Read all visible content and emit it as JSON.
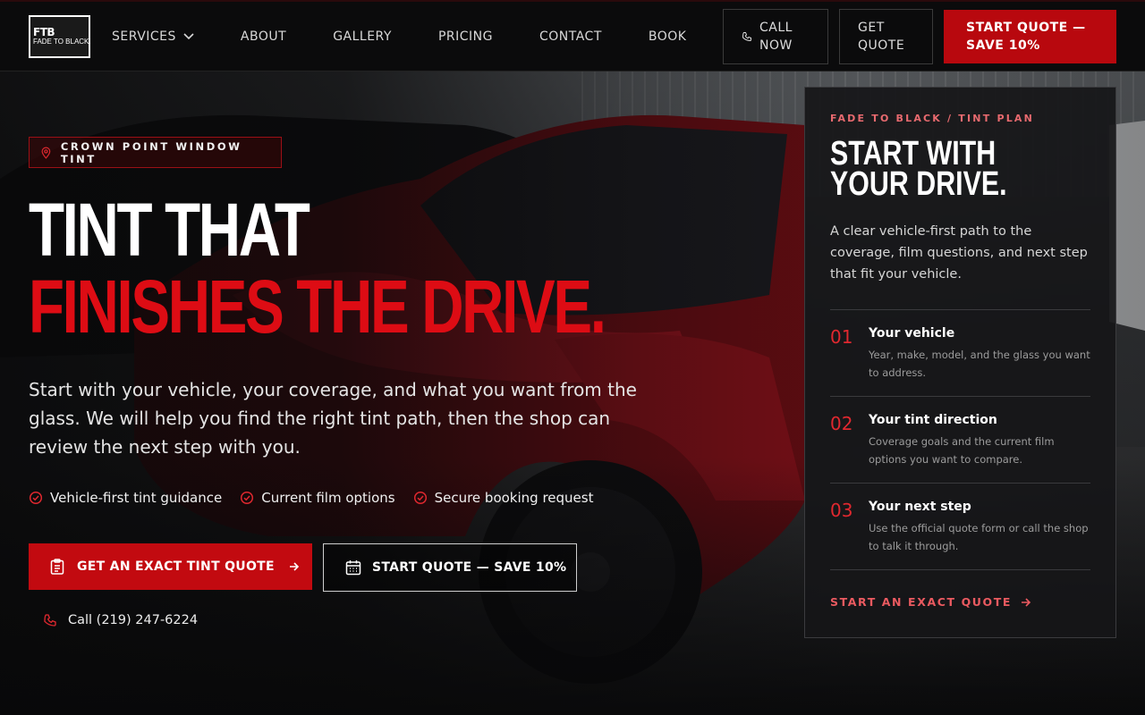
{
  "brand": {
    "logo_mark": "FTB",
    "logo_sub": "FADE TO BLACK"
  },
  "nav": {
    "items": [
      "SERVICES",
      "ABOUT",
      "GALLERY",
      "PRICING",
      "CONTACT",
      "BOOK"
    ]
  },
  "header_actions": {
    "call_line1": "CALL",
    "call_line2": "NOW",
    "get_line1": "GET",
    "get_line2": "QUOTE",
    "primary_line1": "START QUOTE —",
    "primary_line2": "SAVE 10%"
  },
  "hero": {
    "badge": "CROWN POINT WINDOW TINT",
    "headline_line1": "TINT THAT",
    "headline_line2": "FINISHES THE DRIVE.",
    "lede": "Start with your vehicle, your coverage, and what you want from the glass. We will help you find the right tint path, then the shop can review the next step with you.",
    "checks": [
      "Vehicle-first tint guidance",
      "Current film options",
      "Secure booking request"
    ],
    "cta_primary": "GET AN EXACT TINT QUOTE",
    "cta_secondary": "START QUOTE — SAVE 10%",
    "phone": "Call (219) 247-6224"
  },
  "plan_card": {
    "eyebrow": "FADE TO BLACK / TINT PLAN",
    "title_line1": "START WITH",
    "title_line2": "YOUR DRIVE.",
    "description": "A clear vehicle-first path to the coverage, film questions, and next step that fit your vehicle.",
    "steps": [
      {
        "num": "01",
        "title": "Your vehicle",
        "desc": "Year, make, model, and the glass you want to address."
      },
      {
        "num": "02",
        "title": "Your tint direction",
        "desc": "Coverage goals and the current film options you want to compare."
      },
      {
        "num": "03",
        "title": "Your next step",
        "desc": "Use the official quote form or call the shop to talk it through."
      }
    ],
    "cta": "START AN EXACT QUOTE"
  },
  "colors": {
    "accent_red": "#c20a10",
    "headline_red": "#dd0c14",
    "eyebrow_red": "#e86a6f",
    "background": "#0a0a0b"
  },
  "icons": [
    "chevron-down-icon",
    "phone-icon",
    "map-pin-icon",
    "check-circle-icon",
    "clipboard-icon",
    "arrow-right-icon",
    "calendar-icon"
  ]
}
